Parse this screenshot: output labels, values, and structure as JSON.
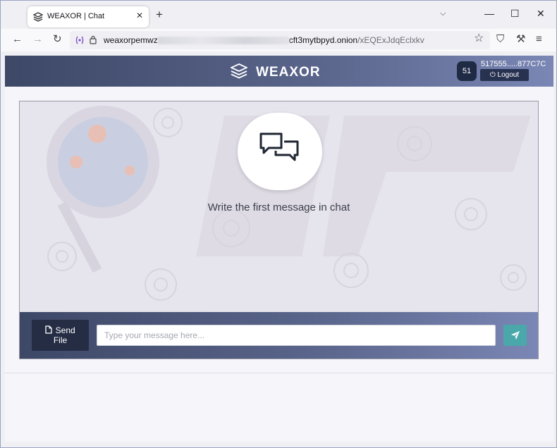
{
  "browser": {
    "tab_title": "WEAXOR | Chat",
    "tab_close_glyph": "✕",
    "new_tab_glyph": "+",
    "list_tabs_glyph": "⌵",
    "minimize_glyph": "—",
    "maximize_glyph": "☐",
    "close_glyph": "✕",
    "back_glyph": "←",
    "forward_glyph": "→",
    "reload_glyph": "↻",
    "url": {
      "prefix": "weaxorpemwz",
      "domain_suffix": "cft3mytbpyd.onion",
      "path": "/xEQExJdqEclxkv"
    },
    "bookmark_glyph": "☆",
    "menu_glyph": "≡",
    "shield_glyph": "⛉",
    "tools_glyph": "⚒"
  },
  "app": {
    "brand": "WEAXOR",
    "user": {
      "avatar_initials": "51",
      "id": "517555.....877C7C",
      "logout_label": "⏻ Logout"
    },
    "chat": {
      "empty_message": "Write the first message in chat",
      "send_file_label_line1": "Send",
      "send_file_label_line2": "File",
      "input_placeholder": "Type your message here..."
    }
  },
  "colors": {
    "header_start": "#3d4766",
    "header_end": "#7a86b4",
    "send_button": "#4aa8ab",
    "send_file_button": "#252d45"
  }
}
